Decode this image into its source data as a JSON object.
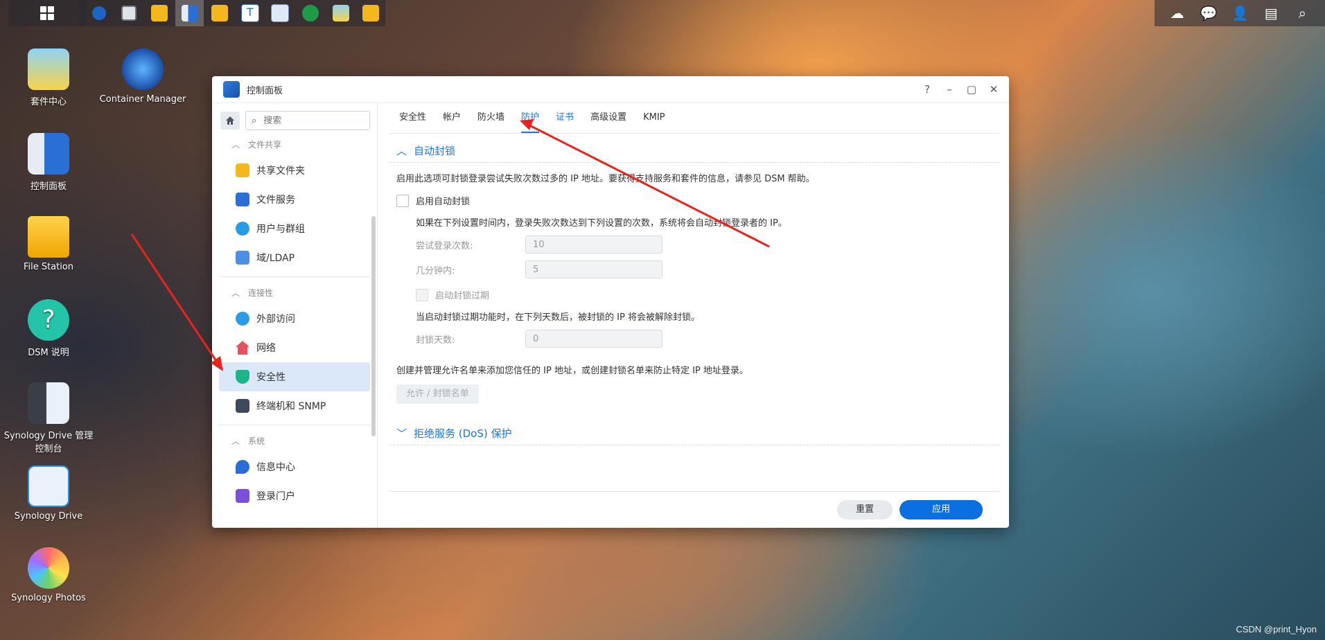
{
  "taskbar": {
    "apps": [
      "container-manager",
      "resource-monitor",
      "folder",
      "control-panel",
      "folder",
      "text-editor",
      "network",
      "security-advisor",
      "package-center",
      "folder"
    ]
  },
  "tray": {
    "icons": [
      "cloud-sync-icon",
      "chat-icon",
      "user-icon",
      "widgets-icon",
      "search-icon"
    ]
  },
  "desktop": {
    "icons": [
      {
        "label": "套件中心",
        "icon": "package-center-icon"
      },
      {
        "label": "Container Manager",
        "icon": "container-manager-icon"
      },
      {
        "label": "控制面板",
        "icon": "control-panel-icon"
      },
      {
        "label": "File Station",
        "icon": "file-station-icon"
      },
      {
        "label": "DSM 说明",
        "icon": "help-icon"
      },
      {
        "label": "Synology Drive 管理控制台",
        "icon": "drive-admin-icon"
      },
      {
        "label": "Synology Drive",
        "icon": "drive-icon"
      },
      {
        "label": "Synology Photos",
        "icon": "photos-icon"
      }
    ]
  },
  "window": {
    "title": "控制面板",
    "controls": [
      "?",
      "–",
      "▢",
      "✕"
    ],
    "search_placeholder": "搜索",
    "sections": [
      {
        "label": "文件共享",
        "items": [
          "共享文件夹",
          "文件服务",
          "用户与群组",
          "域/LDAP"
        ]
      },
      {
        "label": "连接性",
        "items": [
          "外部访问",
          "网络",
          "安全性",
          "终端机和 SNMP"
        ]
      },
      {
        "label": "系统",
        "items": [
          "信息中心",
          "登录门户"
        ]
      }
    ],
    "tabs": [
      "安全性",
      "帐户",
      "防火墙",
      "防护",
      "证书",
      "高级设置",
      "KMIP"
    ],
    "auto_block": {
      "header": "自动封锁",
      "desc": "启用此选项可封锁登录尝试失败次数过多的 IP 地址。要获得支持服务和套件的信息，请参见 DSM 帮助。",
      "enable_label": "启用自动封锁",
      "rule_text": "如果在下列设置时间内，登录失败次数达到下列设置的次数，系统将会自动封锁登录者的 IP。",
      "attempts_label": "尝试登录次数:",
      "attempts_value": "10",
      "minutes_label": "几分钟内:",
      "minutes_value": "5",
      "expire_label": "启动封锁过期",
      "expire_text": "当启动封锁过期功能时，在下列天数后，被封锁的 IP 将会被解除封锁。",
      "days_label": "封锁天数:",
      "days_value": "0",
      "list_text": "创建并管理允许名单来添加您信任的 IP 地址，或创建封锁名单来防止特定 IP 地址登录。",
      "list_button": "允许 / 封锁名单"
    },
    "dos": {
      "header": "拒绝服务 (DoS) 保护"
    },
    "footer": {
      "reset": "重置",
      "apply": "应用"
    }
  },
  "watermark": "CSDN @print_Hyon",
  "colors": {
    "accent": "#0a6fe0",
    "active_item_bg": "#dbe8f9",
    "annotation_arrow": "#e8231a"
  }
}
